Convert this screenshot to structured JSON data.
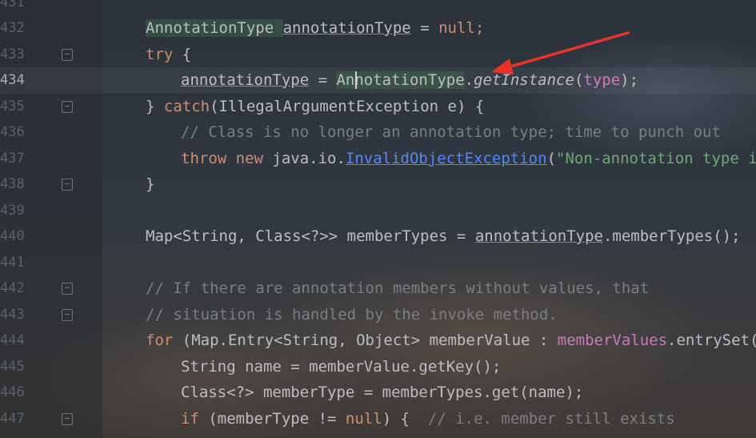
{
  "lines": [
    {
      "num": "431"
    },
    {
      "num": "432",
      "segs": [
        {
          "text": "AnnotationType ",
          "cls": "t hl"
        },
        {
          "text": "annotationType",
          "cls": "t ul"
        },
        {
          "text": " = ",
          "cls": "t"
        },
        {
          "text": "null",
          "cls": "kw"
        },
        {
          "text": ";",
          "cls": "kw"
        }
      ]
    },
    {
      "num": "433",
      "segs": [
        {
          "text": "try",
          "cls": "kw"
        },
        {
          "text": " {",
          "cls": "t"
        }
      ]
    },
    {
      "num": "434",
      "segs": [
        {
          "text": "annotationType",
          "cls": "t ul"
        },
        {
          "text": " = ",
          "cls": "t"
        },
        {
          "text": "AnnotationType",
          "cls": "t hl"
        },
        {
          "text": ".",
          "cls": "t"
        },
        {
          "text": "getInstance",
          "cls": "it"
        },
        {
          "text": "(",
          "cls": "t"
        },
        {
          "text": "type",
          "cls": "fld"
        },
        {
          "text": ");",
          "cls": "t"
        }
      ]
    },
    {
      "num": "435",
      "segs": [
        {
          "text": "} ",
          "cls": "t"
        },
        {
          "text": "catch",
          "cls": "kw"
        },
        {
          "text": "(IllegalArgumentException e) {",
          "cls": "t"
        }
      ]
    },
    {
      "num": "436",
      "segs": [
        {
          "text": "// Class is no longer an annotation type; time to punch out",
          "cls": "cm"
        }
      ]
    },
    {
      "num": "437",
      "segs": [
        {
          "text": "throw new ",
          "cls": "kw"
        },
        {
          "text": "java.io.",
          "cls": "t"
        },
        {
          "text": "InvalidObjectException",
          "cls": "link"
        },
        {
          "text": "(",
          "cls": "t"
        },
        {
          "text": "\"Non-annotation type in a",
          "cls": "str"
        }
      ]
    },
    {
      "num": "438",
      "segs": [
        {
          "text": "}",
          "cls": "t"
        }
      ]
    },
    {
      "num": "439"
    },
    {
      "num": "440",
      "segs": [
        {
          "text": "Map<String, Class<?>> memberTypes = ",
          "cls": "t"
        },
        {
          "text": "annotationType",
          "cls": "t ul"
        },
        {
          "text": ".memberTypes();",
          "cls": "t"
        }
      ]
    },
    {
      "num": "441"
    },
    {
      "num": "442",
      "segs": [
        {
          "text": "// If there are annotation members without values, that",
          "cls": "cm"
        }
      ]
    },
    {
      "num": "443",
      "segs": [
        {
          "text": "// situation is handled by the invoke method.",
          "cls": "cm"
        }
      ]
    },
    {
      "num": "444",
      "segs": [
        {
          "text": "for",
          "cls": "kw"
        },
        {
          "text": " (Map.Entry<String, Object> memberValue : ",
          "cls": "t"
        },
        {
          "text": "memberValues",
          "cls": "fld"
        },
        {
          "text": ".entrySet())",
          "cls": "t"
        }
      ]
    },
    {
      "num": "445",
      "segs": [
        {
          "text": "String name = memberValue.getKey();",
          "cls": "t"
        }
      ]
    },
    {
      "num": "446",
      "segs": [
        {
          "text": "Class<?> memberType = memberTypes.get(name);",
          "cls": "t"
        }
      ]
    },
    {
      "num": "447",
      "segs": [
        {
          "text": "if",
          "cls": "kw"
        },
        {
          "text": " (memberType != ",
          "cls": "t"
        },
        {
          "text": "null",
          "cls": "kw"
        },
        {
          "text": ") {  ",
          "cls": "t"
        },
        {
          "text": "// i.e. member still exists",
          "cls": "cm"
        }
      ]
    }
  ],
  "colors": {
    "keyword": "#cf8e6d",
    "comment": "#7a7e85",
    "string": "#6aab73",
    "field": "#c77dbb",
    "link": "#548af7",
    "annotation_arrow": "#e8332a"
  }
}
